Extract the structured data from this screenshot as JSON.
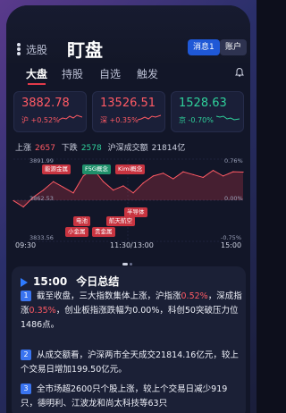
{
  "header": {
    "nav_xuangu": "选股",
    "nav_dingpan": "盯盘",
    "message_button": "消息1",
    "account_button": "账户"
  },
  "tabs": [
    "大盘",
    "持股",
    "自选",
    "触发"
  ],
  "index_cards": [
    {
      "value": "3882.78",
      "market": "沪",
      "change": "+0.52%",
      "direction": "up"
    },
    {
      "value": "13526.51",
      "market": "深",
      "change": "+0.35%",
      "direction": "up"
    },
    {
      "value": "1528.63",
      "market": "京",
      "change": "-0.70%",
      "direction": "down"
    }
  ],
  "breadth": {
    "up_label": "上涨",
    "up_count": "2657",
    "down_label": "下跌",
    "down_count": "2578",
    "turnover_label": "沪深成交额",
    "turnover": "21814亿"
  },
  "chart": {
    "y_top": "3891.99",
    "y_mid": "3862.53",
    "y_bottom": "3833.56",
    "pct_top": "0.76%",
    "pct_mid": "0.00%",
    "pct_bottom": "-0.75%",
    "time_start": "09:30",
    "time_mid": "11:30/13:00",
    "time_end": "15:00",
    "tags": [
      {
        "label": "能源金属",
        "color": "red"
      },
      {
        "label": "F5G概念",
        "color": "green"
      },
      {
        "label": "Kimi概念",
        "color": "red"
      },
      {
        "label": "电池",
        "color": "red"
      },
      {
        "label": "小金属",
        "color": "red"
      },
      {
        "label": "航天航空",
        "color": "red"
      },
      {
        "label": "半导体",
        "color": "red"
      },
      {
        "label": "贵金属",
        "color": "red"
      }
    ]
  },
  "chart_data": {
    "type": "line",
    "ylim": [
      3833.56,
      3891.99
    ],
    "series": [
      {
        "values": [
          3862.5,
          3858,
          3865,
          3870,
          3876,
          3872,
          3868,
          3880,
          3885,
          3876,
          3870,
          3873,
          3868,
          3875,
          3880,
          3882,
          3878,
          3883,
          3881,
          3879,
          3884,
          3880,
          3883,
          3882.78
        ]
      }
    ]
  },
  "summary": {
    "time": "15:00",
    "title": "今日总结",
    "items": [
      {
        "n": "1",
        "segments": [
          "截至收盘，三大指数集体上涨，沪指涨",
          "0.52%",
          "，深成指涨",
          "0.35%",
          "，创业板指涨跌幅为0.00%，科创50突破压力位1486点。"
        ]
      },
      {
        "n": "2",
        "text": "从成交额看，沪深两市全天成交21814.16亿元，较上个交易日增加199.50亿元。"
      },
      {
        "n": "3",
        "text": "全市场超2600只个股上涨，较上个交易日减少919只，德明利、江波龙和尚太科技等63只"
      }
    ]
  }
}
